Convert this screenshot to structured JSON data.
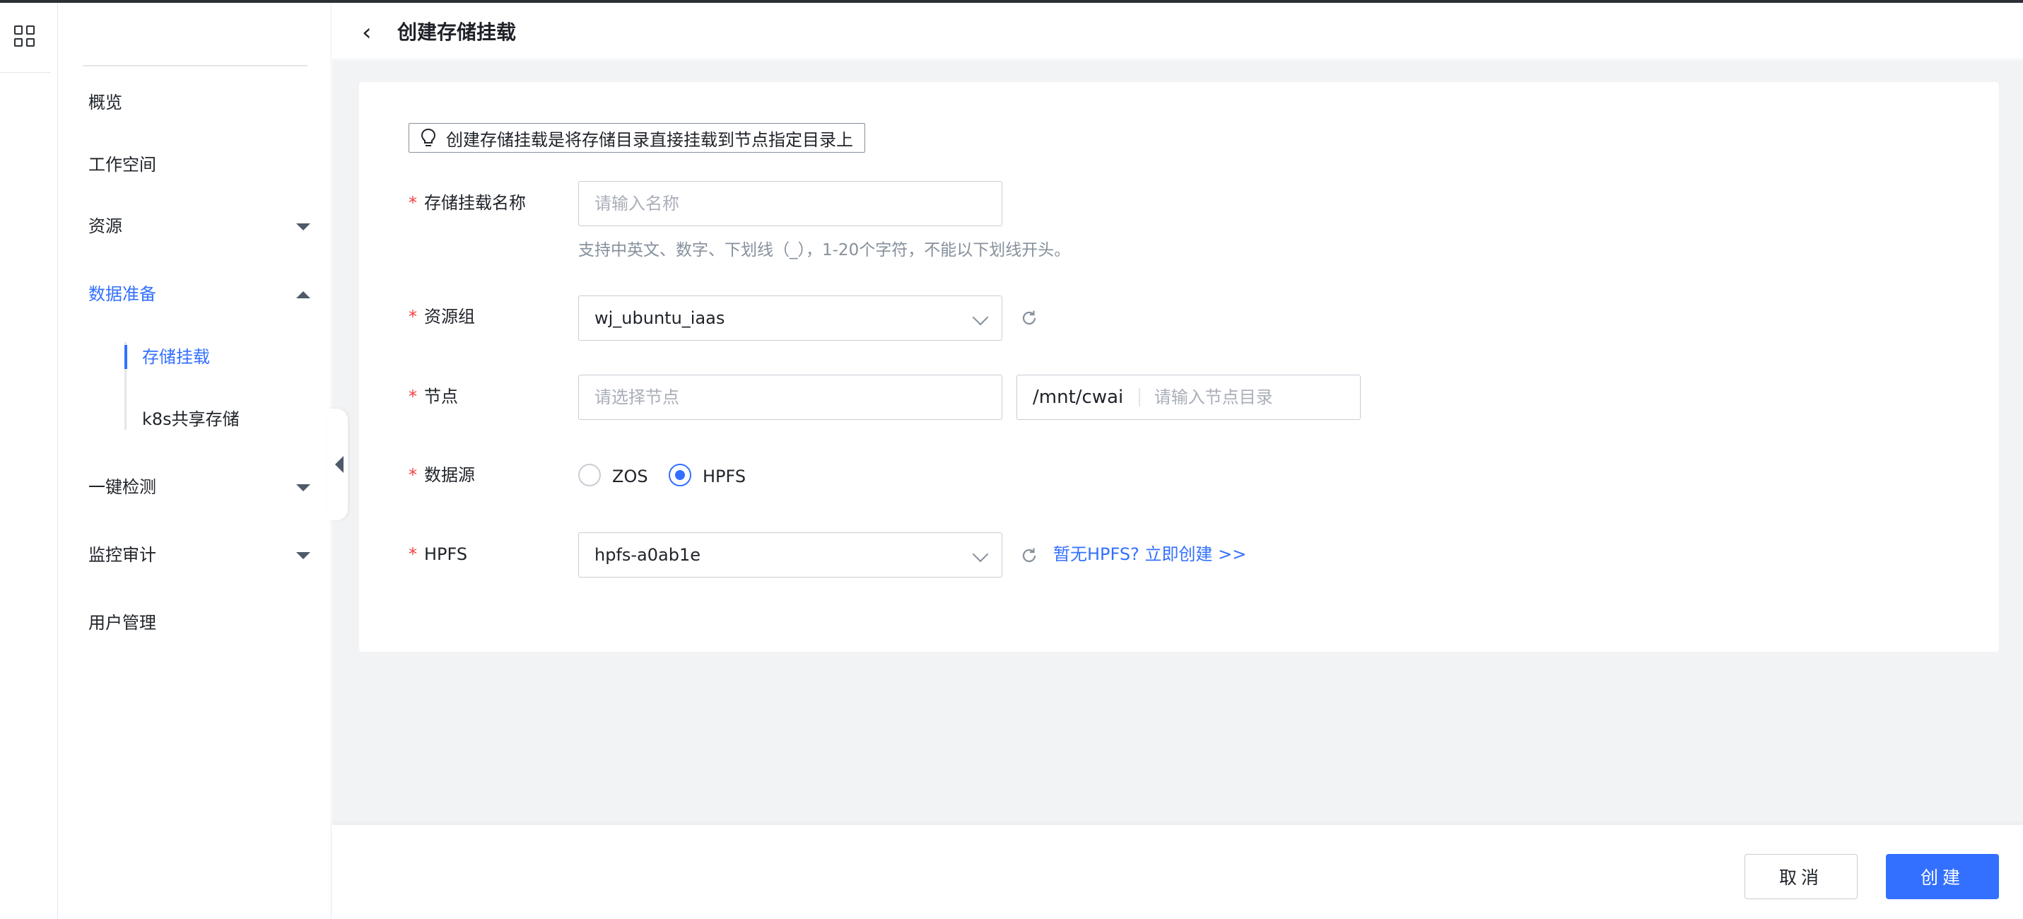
{
  "header": {
    "back_glyph": "‹",
    "title": "创建存储挂载"
  },
  "sidebar": {
    "items": [
      {
        "label": "概览"
      },
      {
        "label": "工作空间"
      },
      {
        "label": "资源"
      },
      {
        "label": "数据准备"
      },
      {
        "label": "一键检测"
      },
      {
        "label": "监控审计"
      },
      {
        "label": "用户管理"
      }
    ],
    "sub_items": [
      {
        "label": "存储挂载"
      },
      {
        "label": "k8s共享存储"
      }
    ]
  },
  "form": {
    "tip": "创建存储挂载是将存储目录直接挂载到节点指定目录上",
    "required_mark": "*",
    "name": {
      "label": "存储挂载名称",
      "placeholder": "请输入名称",
      "help": "支持中英文、数字、下划线（_），1-20个字符，不能以下划线开头。"
    },
    "resource_group": {
      "label": "资源组",
      "value": "wj_ubuntu_iaas"
    },
    "node": {
      "label": "节点",
      "placeholder": "请选择节点",
      "path_prefix": "/mnt/cwai",
      "path_placeholder": "请输入节点目录"
    },
    "datasource": {
      "label": "数据源",
      "options": [
        {
          "label": "ZOS",
          "checked": false
        },
        {
          "label": "HPFS",
          "checked": true
        }
      ]
    },
    "hpfs": {
      "label": "HPFS",
      "value": "hpfs-a0ab1e",
      "link": "暂无HPFS?  立即创建 >>"
    }
  },
  "footer": {
    "cancel_label": "取消",
    "create_label": "创建"
  },
  "colors": {
    "accent": "#3370ff",
    "required": "#f53f3f",
    "background": "#f2f3f5"
  }
}
